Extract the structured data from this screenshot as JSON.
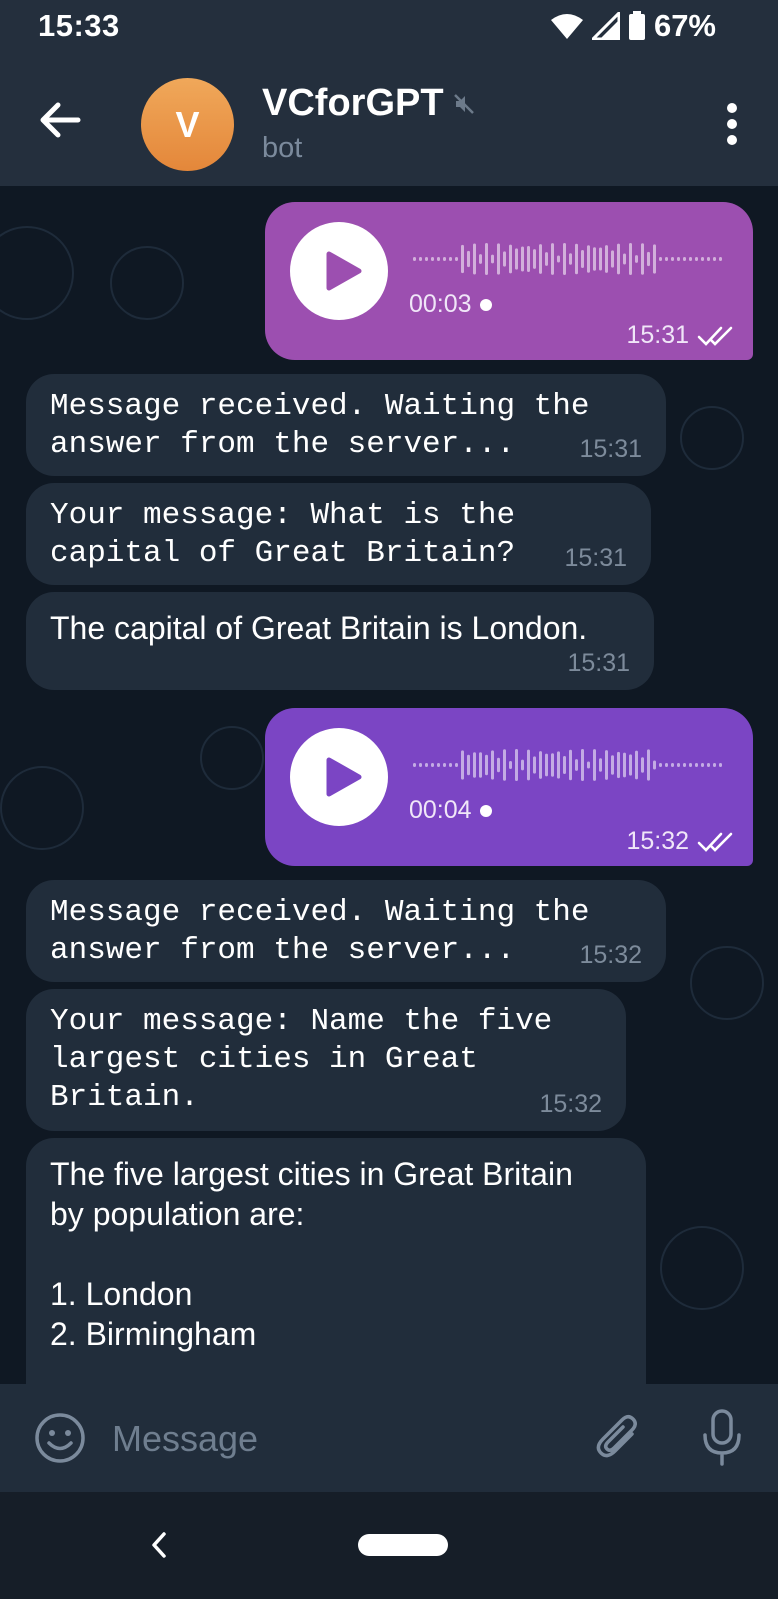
{
  "status": {
    "time": "15:33",
    "battery": "67%"
  },
  "header": {
    "avatar_letter": "V",
    "title": "VCforGPT",
    "subtitle": "bot"
  },
  "messages": [
    {
      "type": "voice",
      "duration": "00:03",
      "time": "15:31",
      "color": "#9c4fb0"
    },
    {
      "type": "text",
      "font": "mono",
      "text": "Message received. Waiting the\nanswer from the server...",
      "time": "15:31"
    },
    {
      "type": "text",
      "font": "mono",
      "text": "Your message: What is the\ncapital of Great Britain?",
      "time": "15:31"
    },
    {
      "type": "text",
      "font": "sans",
      "text": "The capital of Great Britain is London.",
      "time": "15:31"
    },
    {
      "type": "voice",
      "duration": "00:04",
      "time": "15:32",
      "color": "#7b45c4"
    },
    {
      "type": "text",
      "font": "mono",
      "text": "Message received. Waiting the\nanswer from the server...",
      "time": "15:32"
    },
    {
      "type": "text",
      "font": "mono",
      "text": "Your message: Name the five\nlargest cities in Great\nBritain.",
      "time": "15:32"
    },
    {
      "type": "text",
      "font": "sans",
      "text": "The five largest cities in Great Britain\nby population are:\n\n1. London\n2. Birmingham"
    }
  ],
  "composer": {
    "placeholder": "Message"
  },
  "icons": {
    "back": "arrow-left-icon",
    "mute": "muted-speaker-icon",
    "menu": "more-vertical-icon",
    "play": "play-icon",
    "read": "double-check-icon",
    "emoji": "smiley-icon",
    "attach": "paperclip-icon",
    "mic": "microphone-icon"
  }
}
